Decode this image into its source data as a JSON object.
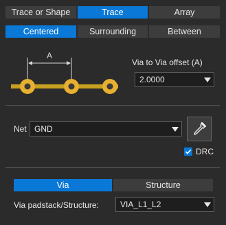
{
  "top_tabs": [
    {
      "label": "Trace or Shape",
      "active": false
    },
    {
      "label": "Trace",
      "active": true
    },
    {
      "label": "Array",
      "active": false
    }
  ],
  "mode_tabs": [
    {
      "label": "Centered",
      "active": true
    },
    {
      "label": "Surrounding",
      "active": false
    },
    {
      "label": "Between",
      "active": false
    }
  ],
  "diagram": {
    "dimension_label": "A"
  },
  "via_offset": {
    "label": "Via to Via offset (A)",
    "value": "2.0000"
  },
  "net": {
    "label": "Net",
    "value": "GND",
    "drc_label": "DRC",
    "drc_checked": true,
    "picker_icon": "eyedropper-icon"
  },
  "bottom_tabs": [
    {
      "label": "Via",
      "active": true
    },
    {
      "label": "Structure",
      "active": false
    }
  ],
  "padstack": {
    "label": "Via padstack/Structure:",
    "value": "VIA_L1_L2"
  },
  "colors": {
    "accent": "#0a78d7",
    "background": "#2b2b2b",
    "trace": "#c8a020",
    "via_copper": "#e8b030",
    "via_hole": "#3a3a3a"
  }
}
